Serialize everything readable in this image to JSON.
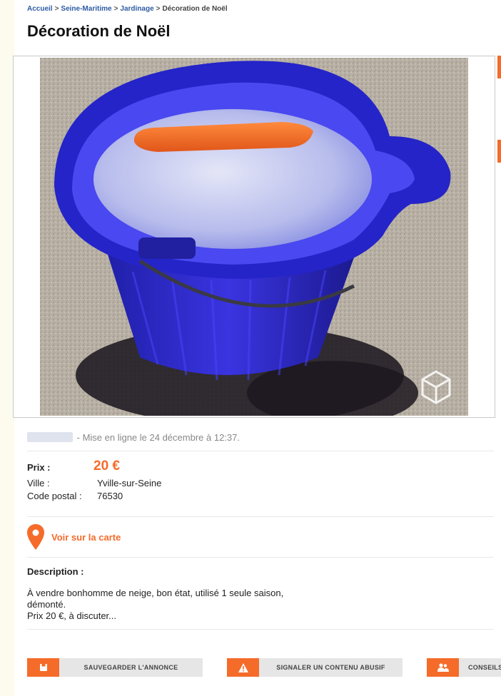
{
  "breadcrumb": {
    "items": [
      "Accueil",
      "Seine-Maritime",
      "Jardinage"
    ],
    "separator": ">",
    "current": "Décoration de Noël"
  },
  "page_title": "Décoration de Noël",
  "photo": {
    "description": "blue-bucket-with-carrot-icon",
    "badge_icon": "cube-watermark-icon"
  },
  "listing": {
    "posted": "- Mise en ligne le 24 décembre à 12:37.",
    "price_label": "Prix :",
    "price_value": "20 €",
    "city_label": "Ville :",
    "city_value": "Yville-sur-Seine",
    "postal_label": "Code postal :",
    "postal_value": "76530"
  },
  "map_link": {
    "label": "Voir sur la carte",
    "icon": "map-pin-icon"
  },
  "description": {
    "title": "Description :",
    "text": "À vendre bonhomme de neige, bon état, utilisé 1 seule saison,\ndémonté.\nPrix 20 €, à discuter..."
  },
  "actions": [
    {
      "label": "SAUVEGARDER L'ANNONCE",
      "icon": "save-icon"
    },
    {
      "label": "SIGNALER UN CONTENU ABUSIF",
      "icon": "warning-icon"
    },
    {
      "label": "CONSEILS",
      "icon": "users-icon"
    }
  ],
  "colors": {
    "accent": "#f56b2a",
    "link": "#2d5ba3",
    "page_bg": "#fdfaee"
  }
}
